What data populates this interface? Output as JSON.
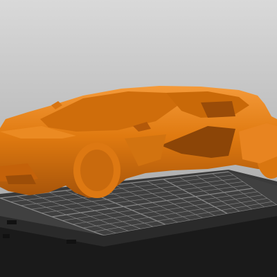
{
  "viewport": {
    "view": "3d-perspective",
    "background_colors": [
      "#d9d9d9",
      "#9c9c9c"
    ]
  },
  "build_plate": {
    "icon": "print-bed-grid",
    "plate_color": "#3a3a3a",
    "grid_line_color": "#8a8a8a",
    "edge_color": "#111111"
  },
  "model": {
    "icon": "sports-car-model",
    "color": "#e07a10",
    "shadow_color": "#a5530a",
    "highlight_color": "#f49a3a"
  }
}
